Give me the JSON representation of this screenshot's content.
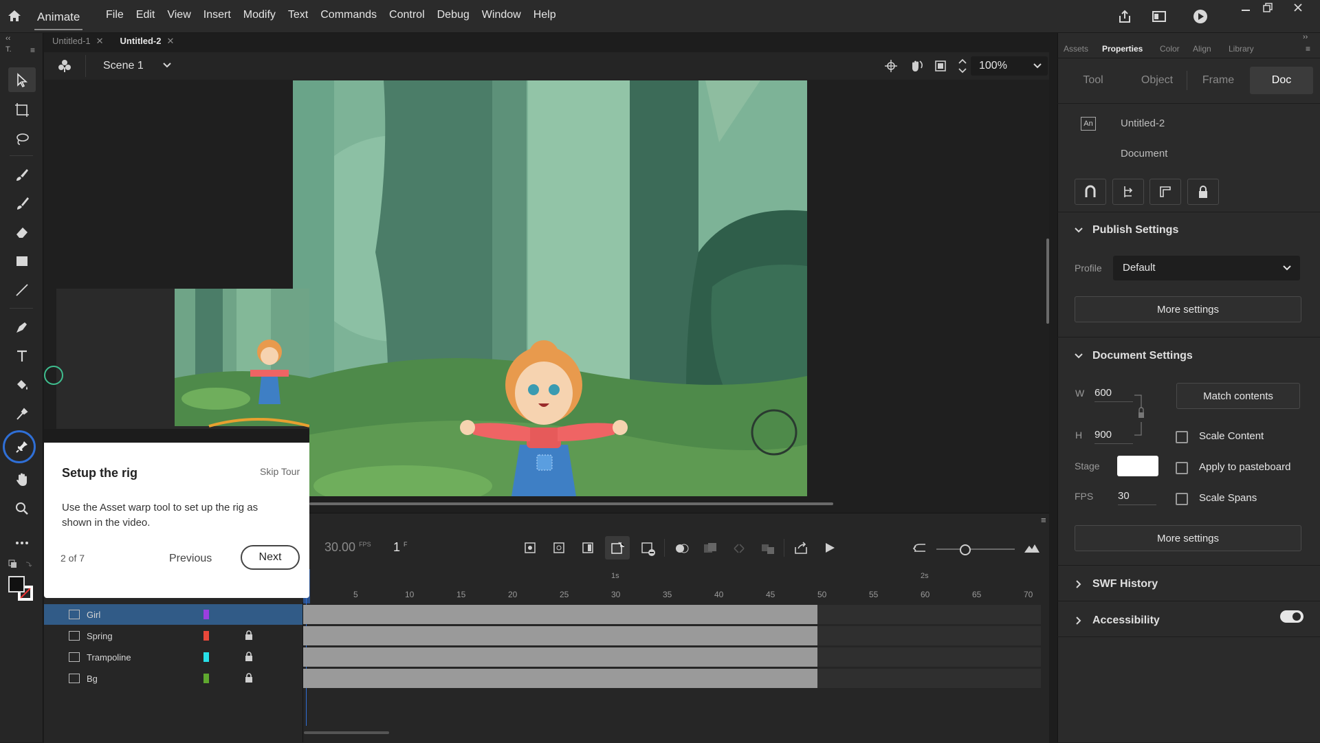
{
  "app": {
    "name": "Animate"
  },
  "menu": [
    "File",
    "Edit",
    "View",
    "Insert",
    "Modify",
    "Text",
    "Commands",
    "Control",
    "Debug",
    "Window",
    "Help"
  ],
  "tabs": [
    {
      "label": "Untitled-1",
      "active": false
    },
    {
      "label": "Untitled-2",
      "active": true
    }
  ],
  "scene": {
    "name": "Scene 1",
    "zoom": "100%"
  },
  "timeline": {
    "fps": "30.00",
    "fps_unit": "FPS",
    "frame": "1",
    "frame_unit": "F",
    "ruler_ticks": [
      "5",
      "10",
      "15",
      "20",
      "25",
      "30",
      "35",
      "40",
      "45",
      "50",
      "55",
      "60",
      "65",
      "70"
    ],
    "second_markers": [
      "1s",
      "2s"
    ],
    "layers": [
      {
        "name": "Girl",
        "color": "#9b3ee0",
        "locked": false,
        "selected": true
      },
      {
        "name": "Spring",
        "color": "#e8483a",
        "locked": true,
        "selected": false
      },
      {
        "name": "Trampoline",
        "color": "#27e0e8",
        "locked": true,
        "selected": false
      },
      {
        "name": "Bg",
        "color": "#5fa82f",
        "locked": true,
        "selected": false
      }
    ]
  },
  "panel": {
    "tabs": [
      "Assets",
      "Properties",
      "Color",
      "Align",
      "Library"
    ],
    "active_tab": "Properties",
    "segments": [
      "Tool",
      "Object",
      "Frame",
      "Doc"
    ],
    "active_segment": "Doc",
    "doc_name": "Untitled-2",
    "doc_type": "Document",
    "doc_badge": "An",
    "publish": {
      "title": "Publish Settings",
      "profile_label": "Profile",
      "profile_value": "Default",
      "more": "More settings"
    },
    "document": {
      "title": "Document Settings",
      "w_label": "W",
      "w": "600",
      "h_label": "H",
      "h": "900",
      "match": "Match contents",
      "scale_content": "Scale Content",
      "stage_label": "Stage",
      "apply_pasteboard": "Apply to pasteboard",
      "fps_label": "FPS",
      "fps": "30",
      "scale_spans": "Scale Spans",
      "more": "More settings"
    },
    "swf_history": "SWF History",
    "accessibility": "Accessibility",
    "accessibility_on": true
  },
  "tour": {
    "title": "Setup the rig",
    "skip": "Skip Tour",
    "body": "Use the Asset warp tool to set up the rig as shown in the video.",
    "step": "2 of 7",
    "previous": "Previous",
    "next": "Next"
  },
  "colors": {
    "accent": "#2f6fd6",
    "stage_sky": "#7fb69a",
    "selection": "#315b87"
  }
}
